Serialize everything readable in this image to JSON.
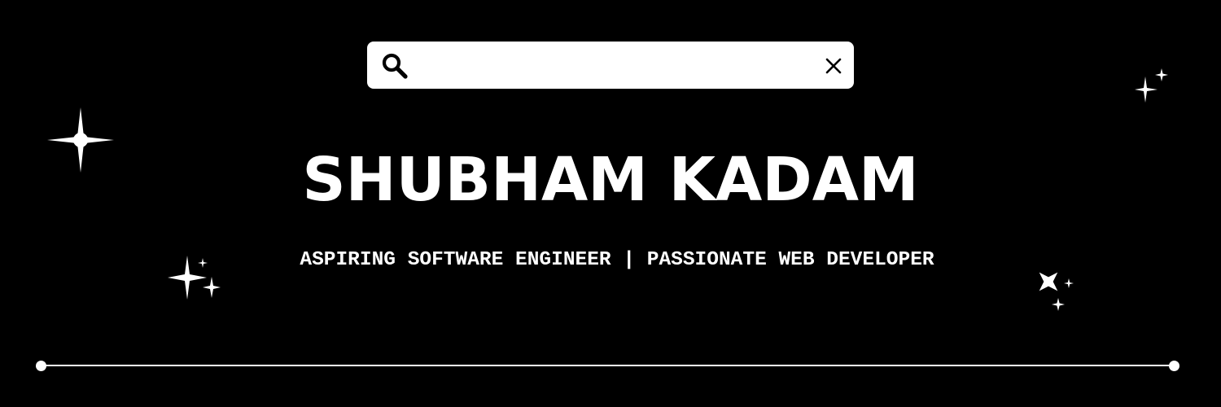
{
  "search": {
    "value": "",
    "icon": "search-icon",
    "clear_icon": "close-icon"
  },
  "banner": {
    "name": "SHUBHAM KADAM",
    "tagline": "ASPIRING SOFTWARE ENGINEER | PASSIONATE WEB DEVELOPER"
  },
  "colors": {
    "background": "#000000",
    "foreground": "#ffffff"
  },
  "decorations": {
    "icons": [
      "sparkle-icon",
      "sparkle-cluster-icon"
    ]
  }
}
